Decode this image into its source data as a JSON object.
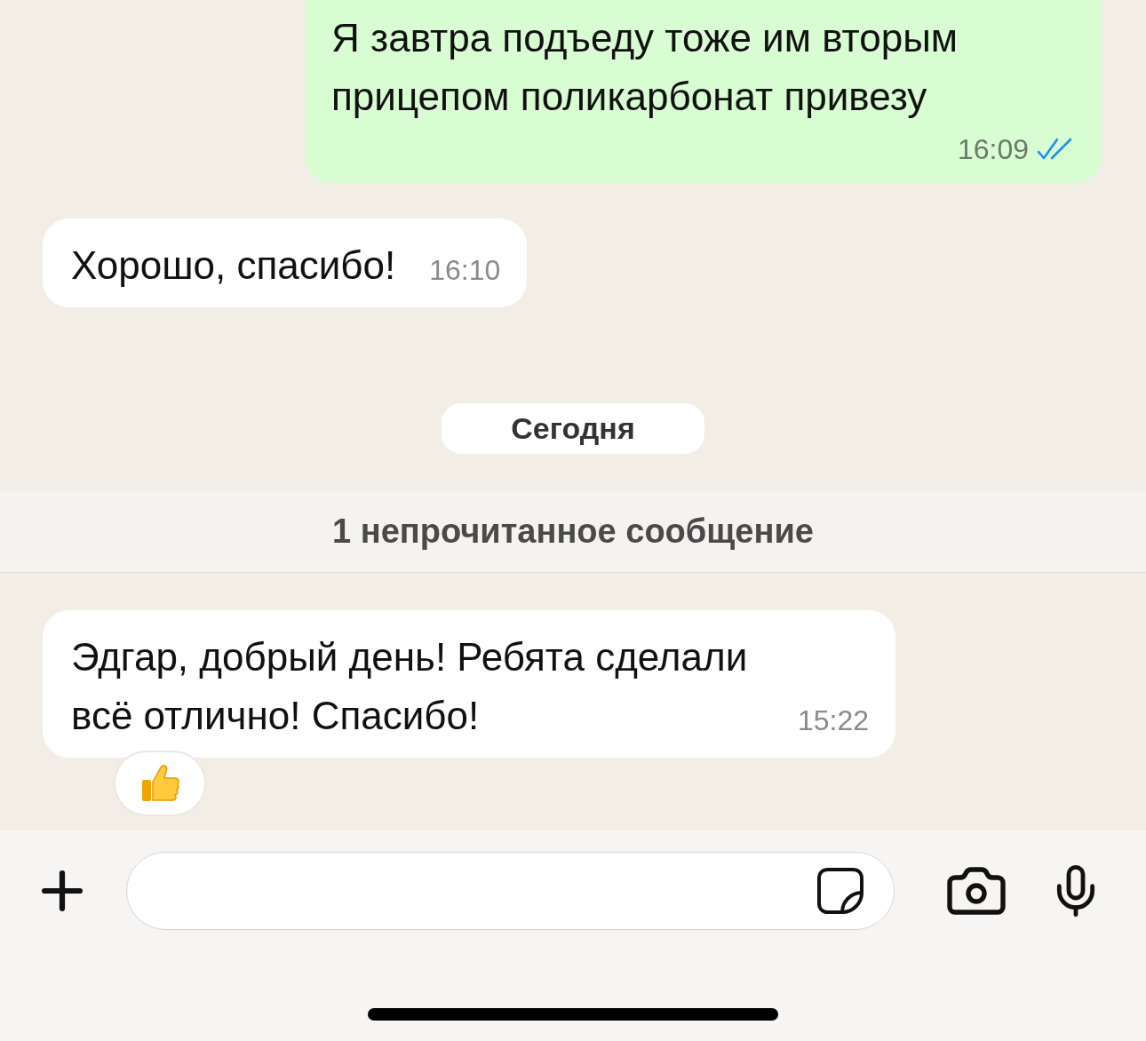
{
  "messages": [
    {
      "kind": "outgoing",
      "text": "Я завтра подъеду тоже им вторым прицепом поликарбонат привезу",
      "time": "16:09",
      "read": true
    },
    {
      "kind": "incoming",
      "text": "Хорошо, спасибо!",
      "time": "16:10"
    },
    {
      "kind": "date",
      "text": "Сегодня"
    },
    {
      "kind": "unread",
      "text": "1 непрочитанное сообщение"
    },
    {
      "kind": "incoming",
      "text": "Эдгар, добрый день! Ребята сделали всё отлично! Спасибо!",
      "time": "15:22",
      "reaction": {
        "kind": "thumbs_up"
      }
    }
  ]
}
